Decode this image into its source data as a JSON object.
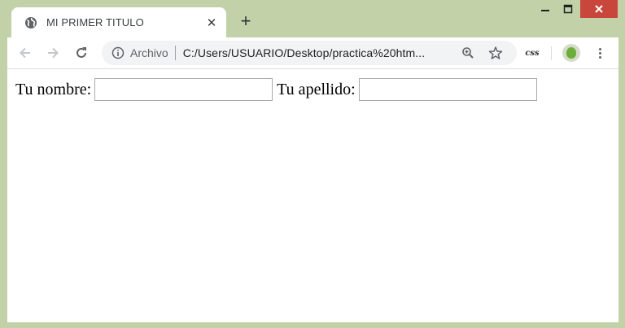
{
  "tab": {
    "title": "MI PRIMER TITULO",
    "close_symbol": "✕",
    "favicon": "globe-icon"
  },
  "new_tab_symbol": "+",
  "window_controls": [
    "minimize-icon",
    "maximize-icon",
    "close-icon"
  ],
  "toolbar": {
    "back": "arrow-left-icon",
    "forward": "arrow-right-icon",
    "reload": "reload-icon"
  },
  "omnibox": {
    "info_icon": "info-icon",
    "scheme_label": "Archivo",
    "url": "C:/Users/USUARIO/Desktop/practica%20htm..."
  },
  "omnibox_actions": [
    "zoom-icon",
    "star-icon"
  ],
  "extension_label": "css",
  "form": {
    "nombre_label": "Tu nombre:",
    "nombre_value": "",
    "apellido_label": "Tu apellido:",
    "apellido_value": ""
  },
  "colors": {
    "frame": "#c2d1a8",
    "close_button": "#c9463d",
    "omnibox_bg": "#f1f3f4",
    "avatar": "#6cae3a"
  }
}
